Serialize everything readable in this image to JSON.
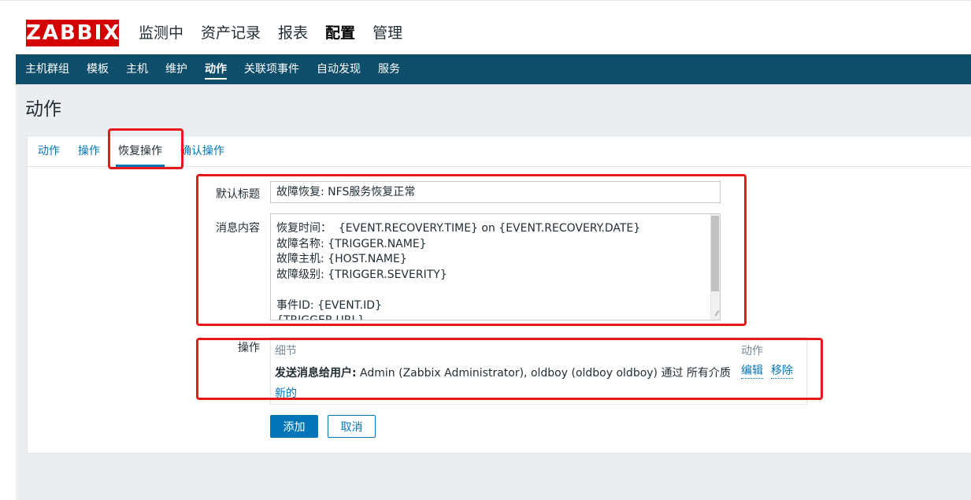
{
  "header": {
    "logo": "ZABBIX",
    "menu": [
      "监测中",
      "资产记录",
      "报表",
      "配置",
      "管理"
    ],
    "active_menu": "配置"
  },
  "subnav": {
    "items": [
      "主机群组",
      "模板",
      "主机",
      "维护",
      "动作",
      "关联项事件",
      "自动发现",
      "服务"
    ],
    "active": "动作"
  },
  "page": {
    "title": "动作"
  },
  "tabs": [
    "动作",
    "操作",
    "恢复操作",
    "确认操作"
  ],
  "active_tab": "恢复操作",
  "form": {
    "subject_label": "默认标题",
    "subject_value": "故障恢复: NFS服务恢复正常",
    "message_label": "消息内容",
    "message_lines": [
      "恢复时间：  {EVENT.RECOVERY.TIME} on {EVENT.RECOVERY.DATE}",
      "故障名称: {TRIGGER.NAME}",
      "故障主机: {HOST.NAME}",
      "故障级别: {TRIGGER.SEVERITY}",
      "",
      "事件ID: {EVENT.ID}",
      "{TRIGGER.URL}"
    ],
    "operations_label": "操作",
    "operations": {
      "col_details": "细节",
      "col_action": "动作",
      "row_prefix": "发送消息给用户:",
      "row_text": " Admin (Zabbix Administrator), oldboy (oldboy oldboy) 通过 所有介质",
      "edit": "编辑",
      "remove": "移除",
      "new": "新的"
    },
    "add_button": "添加",
    "cancel_button": "取消"
  },
  "colors": {
    "brand": "#d40000",
    "nav": "#0e4e6b",
    "link": "#0275b8",
    "highlight": "#e8191b"
  }
}
